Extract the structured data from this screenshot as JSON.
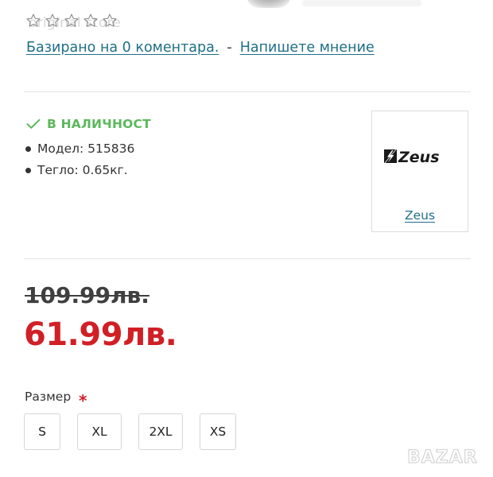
{
  "rating": {
    "stars": 0,
    "max_stars": 5,
    "watermark_text": "original store",
    "reviews_link": "Базирано на 0 коментара.",
    "separator": "-",
    "write_review_link": "Напишете мнение"
  },
  "stock": {
    "status": "В НАЛИЧНОСТ",
    "status_icon": "check-icon",
    "status_color": "#5cb85c"
  },
  "attributes": [
    {
      "text": "Модел: 515836"
    },
    {
      "text": "Тегло: 0.65кг."
    }
  ],
  "brand": {
    "logo_text": "Zeus",
    "link": "Zeus"
  },
  "price": {
    "old": "109.99лв.",
    "new": "61.99лв.",
    "new_color": "#d11f26"
  },
  "size": {
    "label": "Размер",
    "required_mark": "*",
    "options": [
      "S",
      "XL",
      "2XL",
      "XS"
    ]
  },
  "watermark": {
    "text": "BAZAR"
  }
}
